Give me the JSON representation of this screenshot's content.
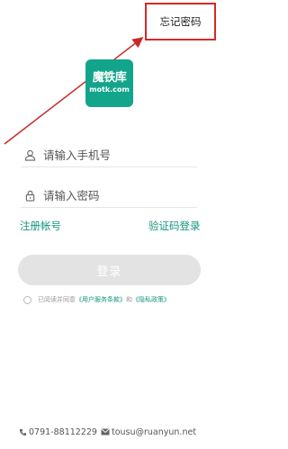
{
  "header": {
    "forgot_password": "忘记密码"
  },
  "logo": {
    "main_text": "魔铁库",
    "sub_text": "motk.com"
  },
  "form": {
    "phone_placeholder": "请输入手机号",
    "password_placeholder": "请输入密码",
    "register_link": "注册帐号",
    "sms_login_link": "验证码登录",
    "login_button": "登录"
  },
  "agreement": {
    "prefix": "已阅读并同意",
    "user_terms": "《用户服务条款》",
    "conjunction": "和",
    "privacy_policy": "《隐私政策》"
  },
  "footer": {
    "phone": "0791-88112229",
    "email": "tousu@ruanyun.net"
  },
  "colors": {
    "brand": "#13a58c",
    "link": "#15957e",
    "highlight": "#d42a2a",
    "button_disabled": "#e3e3e3"
  }
}
